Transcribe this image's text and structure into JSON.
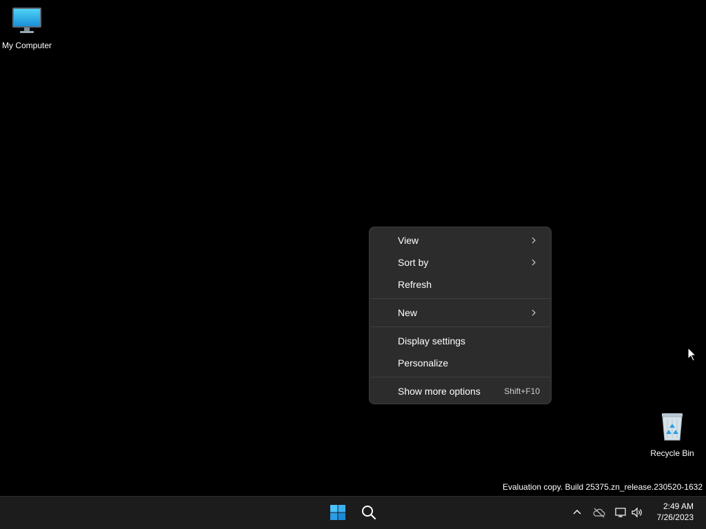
{
  "desktop": {
    "icons": [
      {
        "label": "My Computer",
        "icon": "monitor-icon"
      },
      {
        "label": "Recycle Bin",
        "icon": "recycle-bin-icon"
      }
    ],
    "watermark": "Evaluation copy. Build 25375.zn_release.230520-1632"
  },
  "context_menu": {
    "items": [
      {
        "label": "View",
        "submenu": true
      },
      {
        "label": "Sort by",
        "submenu": true
      },
      {
        "label": "Refresh",
        "submenu": false
      },
      {
        "label": "New",
        "submenu": true
      },
      {
        "label": "Display settings",
        "submenu": false
      },
      {
        "label": "Personalize",
        "submenu": false
      },
      {
        "label": "Show more options",
        "submenu": false,
        "shortcut": "Shift+F10"
      }
    ]
  },
  "taskbar": {
    "start_icon": "windows-start-icon",
    "search_icon": "search-icon",
    "tray": {
      "icons": [
        "chevron-up-icon",
        "cloud-offline-icon",
        "network-icon",
        "volume-icon"
      ]
    },
    "clock": {
      "time": "2:49 AM",
      "date": "7/26/2023"
    }
  },
  "colors": {
    "desktop_bg": "#000000",
    "menu_bg": "#2c2c2c",
    "taskbar_bg": "#1c1c1c",
    "start_blue": "#4cc2ff"
  }
}
